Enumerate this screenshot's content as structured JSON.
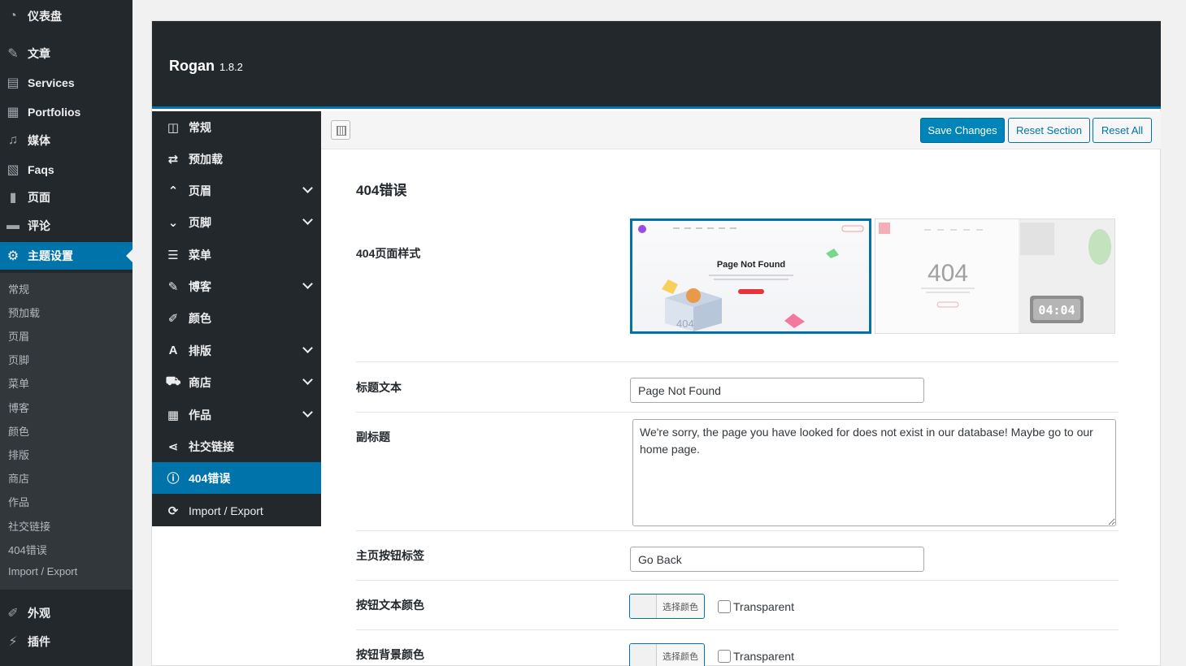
{
  "wp_sidebar": {
    "items": [
      {
        "icon": "dashboard-icon",
        "label": "仪表盘"
      },
      {
        "icon": "pin-icon",
        "label": "文章"
      },
      {
        "icon": "document-icon",
        "label": "Services"
      },
      {
        "icon": "portfolio-icon",
        "label": "Portfolios"
      },
      {
        "icon": "media-icon",
        "label": "媒体"
      },
      {
        "icon": "faq-icon",
        "label": "Faqs"
      },
      {
        "icon": "page-icon",
        "label": "页面"
      },
      {
        "icon": "comment-icon",
        "label": "评论"
      },
      {
        "icon": "gear-icon",
        "label": "主题设置"
      },
      {
        "icon": "brush-icon",
        "label": "外观"
      },
      {
        "icon": "plugin-icon",
        "label": "插件"
      }
    ],
    "submenu": [
      "常规",
      "预加载",
      "页眉",
      "页脚",
      "菜单",
      "博客",
      "颜色",
      "排版",
      "商店",
      "作品",
      "社交链接",
      "404错误",
      "Import / Export"
    ]
  },
  "panel": {
    "title": "Rogan",
    "version": "1.8.2"
  },
  "redux_menu": [
    {
      "icon": "layout-icon",
      "label": "常规"
    },
    {
      "icon": "refresh-icon",
      "label": "预加载"
    },
    {
      "icon": "chevron-up-icon",
      "label": "页眉"
    },
    {
      "icon": "chevron-down-icon",
      "label": "页脚"
    },
    {
      "icon": "menu-icon",
      "label": "菜单"
    },
    {
      "icon": "pin-icon",
      "label": "博客"
    },
    {
      "icon": "brush-icon",
      "label": "颜色"
    },
    {
      "icon": "font-icon",
      "label": "排版"
    },
    {
      "icon": "cart-icon",
      "label": "商店"
    },
    {
      "icon": "portfolio-icon",
      "label": "作品"
    },
    {
      "icon": "share-icon",
      "label": "社交链接"
    },
    {
      "icon": "info-icon",
      "label": "404错误"
    },
    {
      "icon": "sync-icon",
      "label": "Import / Export"
    }
  ],
  "toolbar": {
    "save": "Save Changes",
    "reset_section": "Reset Section",
    "reset_all": "Reset All"
  },
  "section": {
    "title": "404错误",
    "fields": {
      "style_label": "404页面样式",
      "title_label": "标题文本",
      "title_value": "Page Not Found",
      "subtitle_label": "副标题",
      "subtitle_value": "We're sorry, the page you have looked for does not exist in our database! Maybe go to our home page.",
      "home_btn_label": "主页按钮标签",
      "home_btn_value": "Go Back",
      "btn_text_color_label": "按钮文本颜色",
      "btn_bg_color_label": "按钮背景颜色",
      "select_color": "选择颜色",
      "transparent": "Transparent"
    },
    "thumb1": {
      "heading": "Page Not Found",
      "box_text": "404"
    },
    "thumb2": {
      "big": "404",
      "clock": "04:04"
    }
  },
  "colors": {
    "admin_dark": "#23282d",
    "accent": "#0073aa",
    "primary_button": "#0085ba"
  }
}
